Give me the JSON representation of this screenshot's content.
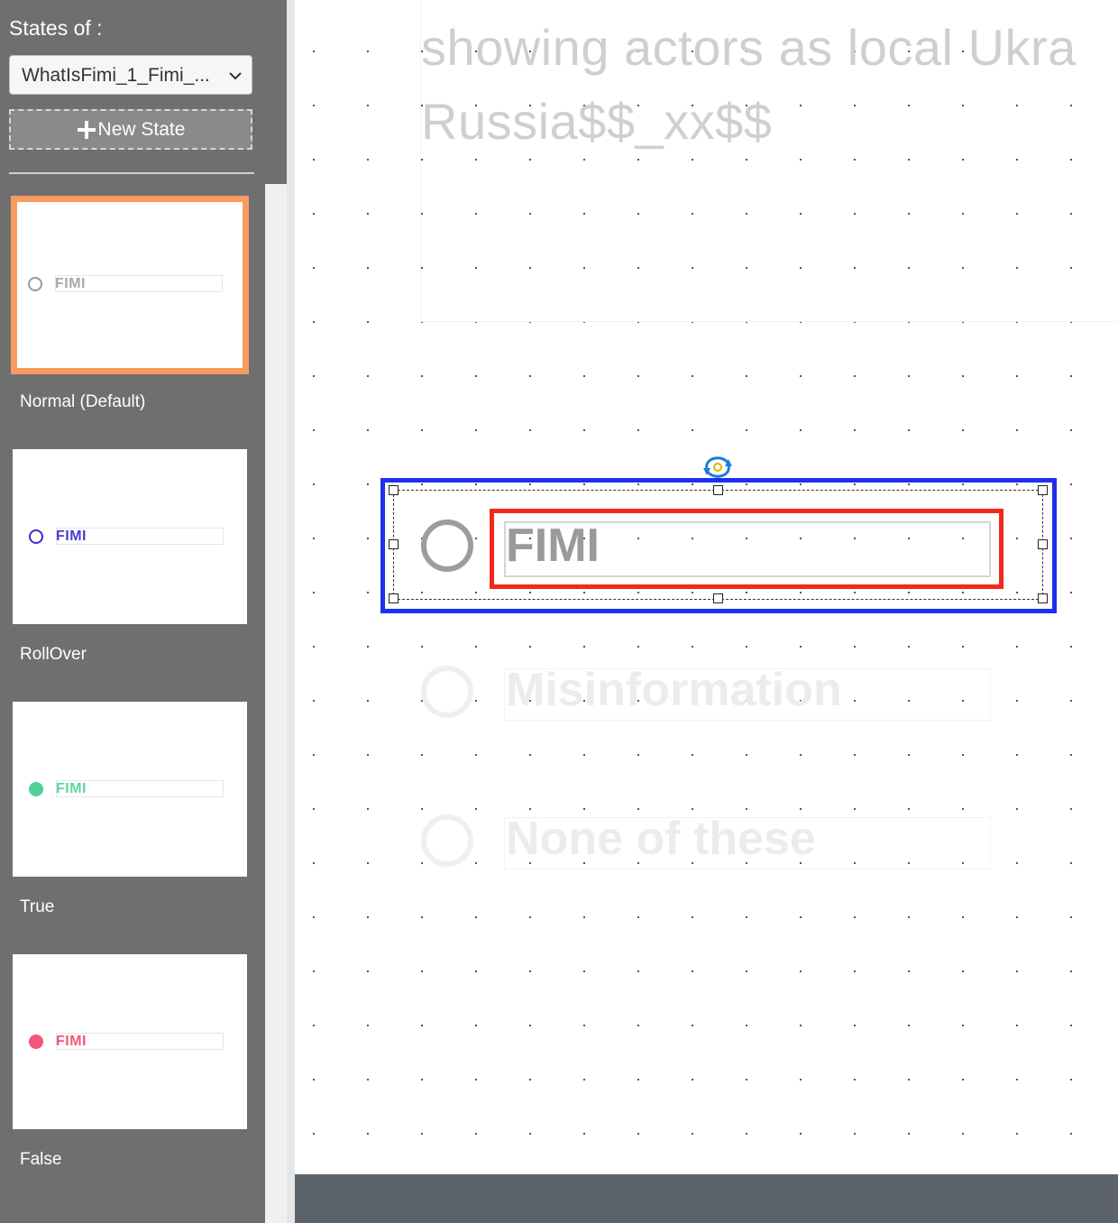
{
  "panel": {
    "title": "States of :",
    "selected_object": "WhatIsFimi_1_Fimi_...",
    "new_state_label": "New State",
    "states": [
      {
        "name": "Normal (Default)",
        "option_label": "FIMI",
        "radio_color": "#9a9a9a",
        "label_color": "#a8a8a8",
        "radio_filled": false,
        "selected": true
      },
      {
        "name": "RollOver",
        "option_label": "FIMI",
        "radio_color": "#3b2bd6",
        "label_color": "#4b3ad8",
        "radio_filled": false,
        "selected": false
      },
      {
        "name": "True",
        "option_label": "FIMI",
        "radio_color": "#4fd197",
        "label_color": "#5fd69f",
        "radio_filled": true,
        "selected": false
      },
      {
        "name": "False",
        "option_label": "FIMI",
        "radio_color": "#f2577a",
        "label_color": "#f2577a",
        "radio_filled": true,
        "selected": false
      }
    ]
  },
  "stage": {
    "background_text": [
      "showing actors as local Ukra",
      "Russia$$_xx$$"
    ],
    "options": [
      {
        "label": "FIMI",
        "selected": true
      },
      {
        "label": "Misinformation",
        "selected": false
      },
      {
        "label": "None of these",
        "selected": false
      }
    ]
  },
  "colors": {
    "panel_bg": "#6f6f6f",
    "selected_card_border": "#f99b61",
    "selection_outline": "#1e2ff0",
    "text_frame_outline": "#f02a1a",
    "bottom_bar": "#5b626a"
  },
  "icons": [
    "chevron-down-icon",
    "plus-icon",
    "rotate-icon"
  ]
}
